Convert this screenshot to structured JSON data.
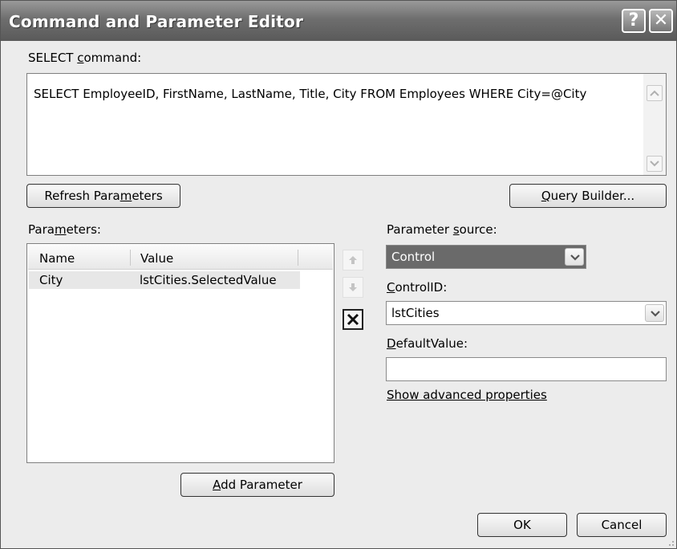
{
  "window": {
    "title": "Command and Parameter Editor",
    "help_glyph": "?",
    "close_glyph": "✕"
  },
  "select_command": {
    "label_pre": "SELECT ",
    "label_key": "c",
    "label_post": "ommand:",
    "value": "SELECT EmployeeID, FirstName, LastName, Title, City FROM Employees WHERE City=@City"
  },
  "buttons": {
    "refresh_pre": "Refresh Para",
    "refresh_key": "m",
    "refresh_post": "eters",
    "query_builder_pre": "",
    "query_builder_key": "Q",
    "query_builder_post": "uery Builder...",
    "add_parameter_pre": "",
    "add_parameter_key": "A",
    "add_parameter_post": "dd Parameter",
    "ok": "OK",
    "cancel": "Cancel"
  },
  "parameters": {
    "label_pre": "Para",
    "label_key": "m",
    "label_post": "eters:",
    "columns": [
      "Name",
      "Value"
    ],
    "rows": [
      {
        "name": "City",
        "value": "lstCities.SelectedValue"
      }
    ]
  },
  "parameter_source": {
    "label_pre": "Parameter ",
    "label_key": "s",
    "label_post": "ource:",
    "selected": "Control"
  },
  "control_id": {
    "label_key": "C",
    "label_post": "ontrolID:",
    "selected": "lstCities"
  },
  "default_value": {
    "label_key": "D",
    "label_post": "efaultValue:",
    "value": ""
  },
  "advanced_link": "Show advanced properties",
  "icons": {
    "move_up": "arrow-up-icon",
    "move_down": "arrow-down-icon",
    "delete": "delete-x-icon"
  }
}
